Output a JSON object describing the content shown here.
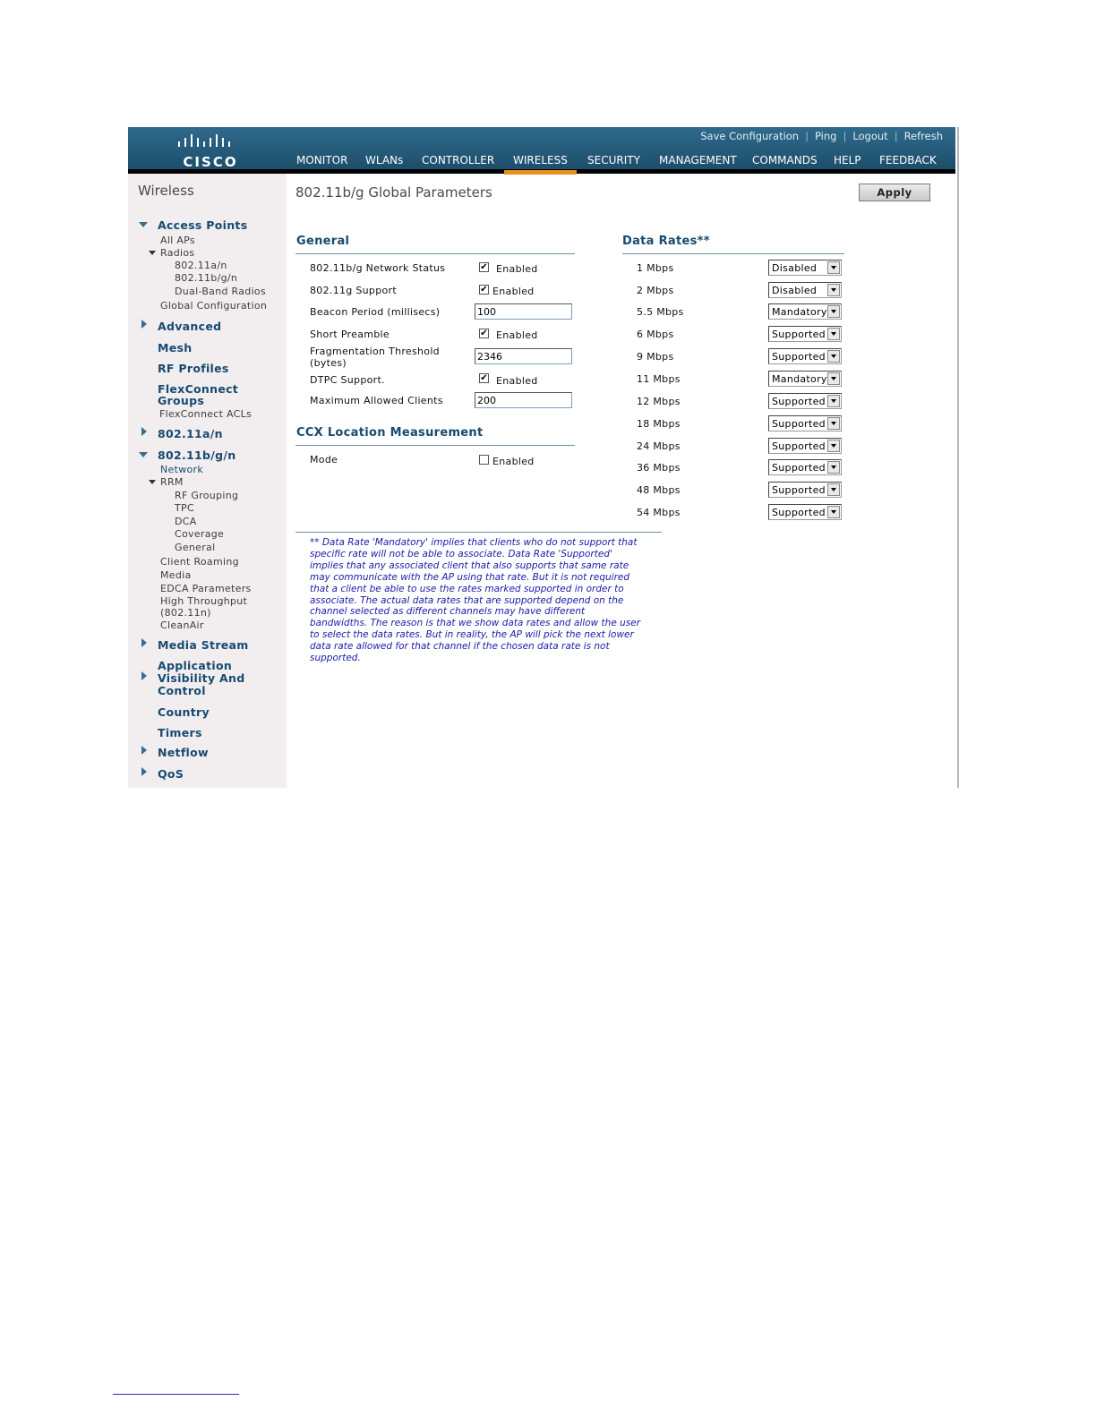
{
  "header": {
    "brand": "CISCO",
    "top_links": [
      "Save Configuration",
      "Ping",
      "Logout",
      "Refresh"
    ],
    "nav": [
      "MONITOR",
      "WLANs",
      "CONTROLLER",
      "WIRELESS",
      "SECURITY",
      "MANAGEMENT",
      "COMMANDS",
      "HELP",
      "FEEDBACK"
    ],
    "active_nav": "WIRELESS",
    "accent_color": "#e8901d"
  },
  "sidebar": {
    "title": "Wireless",
    "access_points": "Access Points",
    "all_aps": "All APs",
    "radios": "Radios",
    "radio_a": "802.11a/n",
    "radio_bg": "802.11b/g/n",
    "dual_band": "Dual-Band Radios",
    "global_config": "Global Configuration",
    "advanced": "Advanced",
    "mesh": "Mesh",
    "rf_profiles": "RF Profiles",
    "flexconnect_groups": "FlexConnect Groups",
    "flexconnect_acls": "FlexConnect ACLs",
    "sec_80211an": "802.11a/n",
    "sec_80211bgn": "802.11b/g/n",
    "network": "Network",
    "rrm": "RRM",
    "rf_grouping": "RF Grouping",
    "tpc": "TPC",
    "dca": "DCA",
    "coverage": "Coverage",
    "general": "General",
    "client_roaming": "Client Roaming",
    "media": "Media",
    "edca": "EDCA Parameters",
    "high_throughput": "High Throughput",
    "high_throughput_2": "(802.11n)",
    "cleanair": "CleanAir",
    "media_stream": "Media Stream",
    "avc_1": "Application",
    "avc_2": "Visibility And",
    "avc_3": "Control",
    "country": "Country",
    "timers": "Timers",
    "netflow": "Netflow",
    "qos": "QoS"
  },
  "main": {
    "title": "802.11b/g Global Parameters",
    "apply": "Apply",
    "general_heading": "General",
    "general": {
      "network_status_label": "802.11b/g Network Status",
      "network_status_checked": true,
      "support_label": "802.11g Support",
      "support_checked": true,
      "beacon_label": "Beacon Period (millisecs)",
      "beacon_value": "100",
      "short_preamble_label": "Short Preamble",
      "short_preamble_checked": true,
      "frag_label_1": "Fragmentation Threshold",
      "frag_label_2": "(bytes)",
      "frag_value": "2346",
      "dtpc_label": "DTPC Support.",
      "dtpc_checked": true,
      "max_clients_label": "Maximum Allowed Clients",
      "max_clients_value": "200",
      "enabled_text": "Enabled"
    },
    "ccx_heading": "CCX Location Measurement",
    "ccx": {
      "mode_label": "Mode",
      "mode_checked": false,
      "enabled_text": "Enabled"
    },
    "rates_heading": "Data Rates**",
    "rates": [
      {
        "rate": "1 Mbps",
        "value": "Disabled"
      },
      {
        "rate": "2 Mbps",
        "value": "Disabled"
      },
      {
        "rate": "5.5 Mbps",
        "value": "Mandatory"
      },
      {
        "rate": "6 Mbps",
        "value": "Supported"
      },
      {
        "rate": "9 Mbps",
        "value": "Supported"
      },
      {
        "rate": "11 Mbps",
        "value": "Mandatory"
      },
      {
        "rate": "12 Mbps",
        "value": "Supported"
      },
      {
        "rate": "18 Mbps",
        "value": "Supported"
      },
      {
        "rate": "24 Mbps",
        "value": "Supported"
      },
      {
        "rate": "36 Mbps",
        "value": "Supported"
      },
      {
        "rate": "48 Mbps",
        "value": "Supported"
      },
      {
        "rate": "54 Mbps",
        "value": "Supported"
      }
    ],
    "note_lines": [
      "** Data Rate 'Mandatory' implies that clients who do not support that",
      "specific rate will not be able to associate. Data Rate 'Supported'",
      "implies that any associated client that also supports that same rate",
      "may communicate with the AP using that rate. But it is not required",
      "that a client be able to use the rates marked supported in order to",
      "associate. The actual data rates that are supported depend on the",
      "channel selected as different channels may have different",
      "bandwidths. The reason is that we show data rates and allow the user",
      "to select the data rates. But in reality, the AP will pick the next lower",
      "data rate allowed for that channel if the chosen data rate is not",
      "supported."
    ]
  }
}
